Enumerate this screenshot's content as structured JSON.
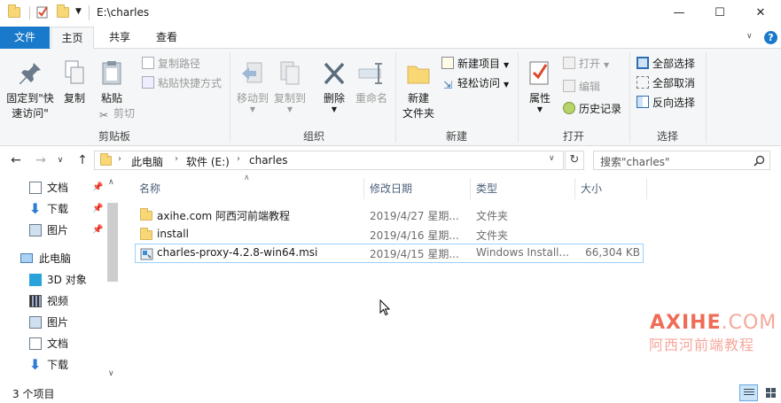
{
  "window": {
    "title": "E:\\charles",
    "controls": {
      "minimize": "—",
      "maximize": "☐",
      "close": "✕"
    }
  },
  "ribbon_tabs": [
    {
      "label": "文件"
    },
    {
      "label": "主页"
    },
    {
      "label": "共享"
    },
    {
      "label": "查看"
    }
  ],
  "help_icon": "?",
  "ribbon": {
    "clipboard": {
      "label": "剪贴板",
      "pin": "固定到\"快\n速访问\"",
      "copy": "复制",
      "paste": "粘贴",
      "copy_path": "复制路径",
      "paste_shortcut": "粘贴快捷方式",
      "cut": "剪切"
    },
    "organize": {
      "label": "组织",
      "move_to": "移动到",
      "copy_to": "复制到",
      "delete": "删除",
      "rename": "重命名"
    },
    "new": {
      "label": "新建",
      "new_folder": "新建\n文件夹",
      "new_item": "新建项目",
      "easy_access": "轻松访问"
    },
    "open": {
      "label": "打开",
      "properties": "属性",
      "open": "打开",
      "edit": "编辑",
      "history": "历史记录"
    },
    "select": {
      "label": "选择",
      "select_all": "全部选择",
      "select_none": "全部取消",
      "invert": "反向选择"
    }
  },
  "address": {
    "crumbs": [
      "此电脑",
      "软件 (E:)",
      "charles"
    ],
    "search_placeholder": "搜索\"charles\""
  },
  "nav_pane": {
    "quick_access": [
      {
        "label": "文档",
        "icon": "documents-icon"
      },
      {
        "label": "下载",
        "icon": "download-icon"
      },
      {
        "label": "图片",
        "icon": "pictures-icon"
      }
    ],
    "this_pc": "此电脑",
    "pc_items": [
      {
        "label": "3D 对象",
        "icon": "3d-objects-icon"
      },
      {
        "label": "视频",
        "icon": "videos-icon"
      },
      {
        "label": "图片",
        "icon": "pictures-icon"
      },
      {
        "label": "文档",
        "icon": "documents-icon"
      },
      {
        "label": "下载",
        "icon": "download-icon"
      }
    ]
  },
  "columns": {
    "name": "名称",
    "date": "修改日期",
    "type": "类型",
    "size": "大小"
  },
  "files": [
    {
      "name": "axihe.com 阿西河前端教程",
      "date": "2019/4/27 星期...",
      "type": "文件夹",
      "size": "",
      "icon": "folder-icon"
    },
    {
      "name": "install",
      "date": "2019/4/16 星期...",
      "type": "文件夹",
      "size": "",
      "icon": "folder-icon"
    },
    {
      "name": "charles-proxy-4.2.8-win64.msi",
      "date": "2019/4/15 星期...",
      "type": "Windows Install...",
      "size": "66,304 KB",
      "icon": "msi-installer-icon"
    }
  ],
  "status": {
    "item_count": "3 个项目"
  },
  "watermark": {
    "brand": "AXIHE",
    "tld": ".COM",
    "tagline": "阿西河前端教程"
  },
  "colors": {
    "accent": "#1979ca",
    "selection_border": "#99d1ff",
    "watermark": "#ef6c57"
  }
}
